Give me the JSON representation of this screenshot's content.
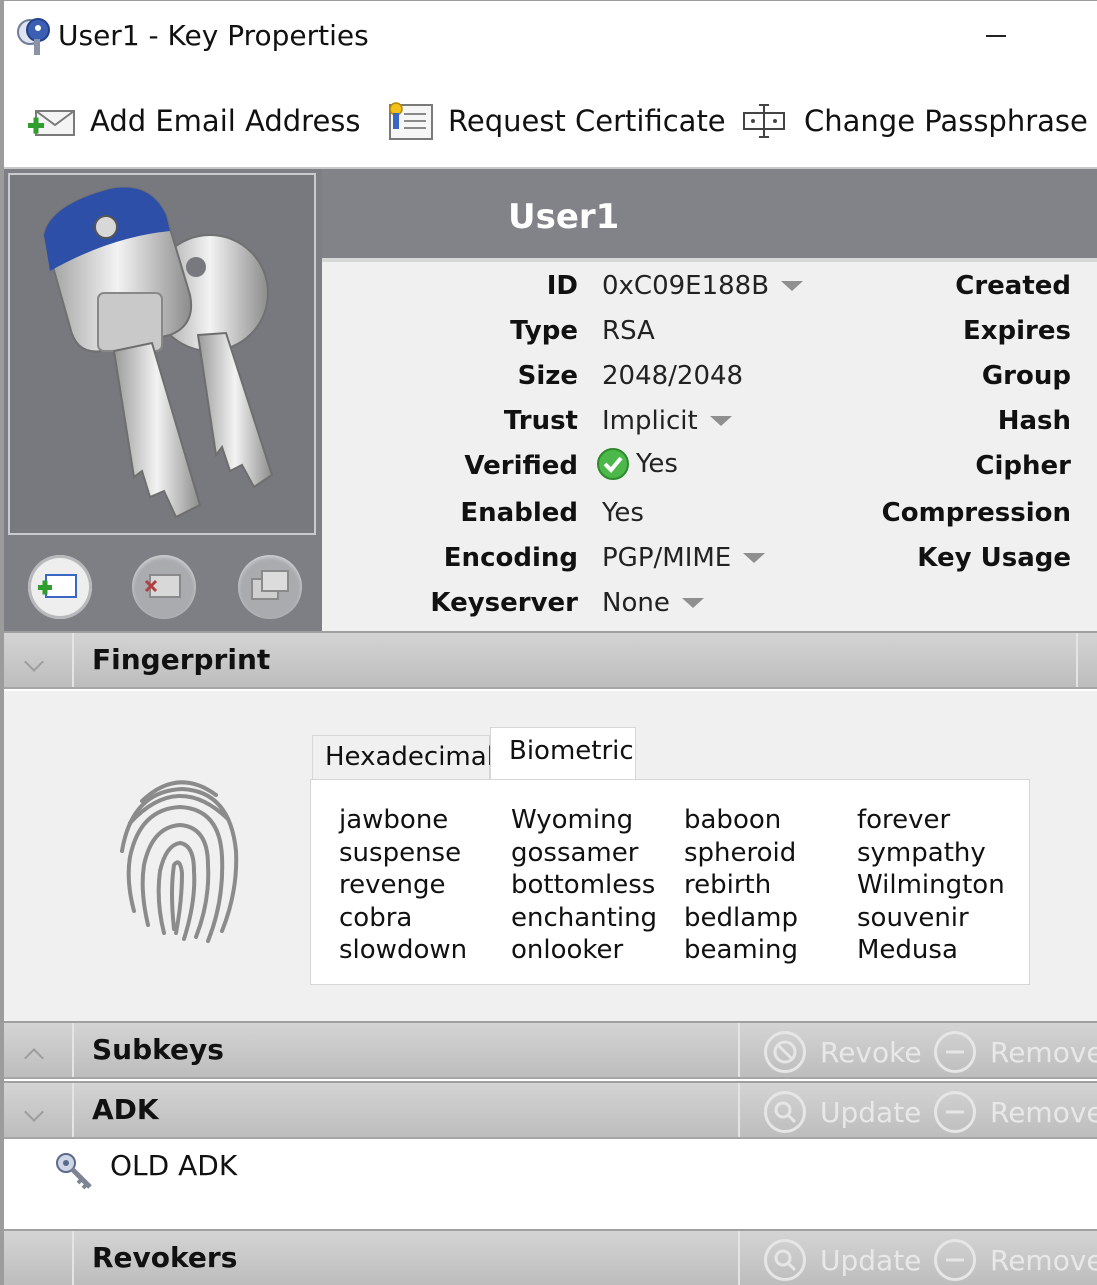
{
  "window": {
    "title": "User1 - Key Properties"
  },
  "toolbar": {
    "add_email": "Add Email Address",
    "request_cert": "Request Certificate",
    "change_pass": "Change Passphrase"
  },
  "key": {
    "name": "User1",
    "props": {
      "id_label": "ID",
      "id_value": "0xC09E188B",
      "type_label": "Type",
      "type_value": "RSA",
      "size_label": "Size",
      "size_value": "2048/2048",
      "trust_label": "Trust",
      "trust_value": "Implicit",
      "verified_label": "Verified",
      "verified_value": "Yes",
      "enabled_label": "Enabled",
      "enabled_value": "Yes",
      "encoding_label": "Encoding",
      "encoding_value": "PGP/MIME",
      "keyserver_label": "Keyserver",
      "keyserver_value": "None"
    },
    "right_props": {
      "created": "Created",
      "expires": "Expires",
      "group": "Group",
      "hash": "Hash",
      "cipher": "Cipher",
      "compression": "Compression",
      "key_usage": "Key Usage"
    }
  },
  "fingerprint": {
    "title": "Fingerprint",
    "tabs": {
      "hex": "Hexadecimal",
      "bio": "Biometric"
    },
    "words": [
      [
        "jawbone",
        "suspense",
        "revenge",
        "cobra",
        "slowdown"
      ],
      [
        "Wyoming",
        "gossamer",
        "bottomless",
        "enchanting",
        "onlooker"
      ],
      [
        "baboon",
        "spheroid",
        "rebirth",
        "bedlamp",
        "beaming"
      ],
      [
        "forever",
        "sympathy",
        "Wilmington",
        "souvenir",
        "Medusa"
      ]
    ]
  },
  "subkeys": {
    "title": "Subkeys",
    "revoke": "Revoke",
    "remove": "Remove"
  },
  "adk": {
    "title": "ADK",
    "update": "Update",
    "remove": "Remove",
    "item": "OLD ADK"
  },
  "revokers": {
    "title": "Revokers",
    "update": "Update",
    "remove": "Remove"
  }
}
